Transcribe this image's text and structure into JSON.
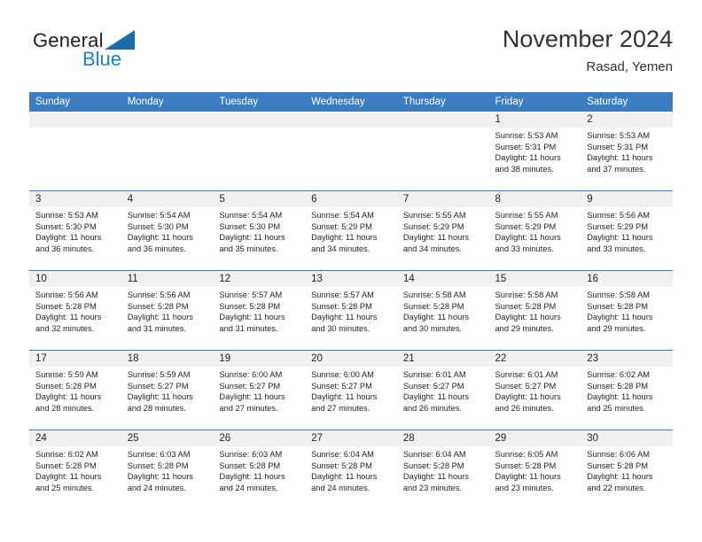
{
  "brand": {
    "name_dark": "General",
    "name_blue": "Blue",
    "triangle_color": "#1b6ca8",
    "blue_color": "#1b7fc4"
  },
  "header": {
    "title": "November 2024",
    "location": "Rasad, Yemen"
  },
  "theme": {
    "header_bg": "#3b7dc0",
    "header_text": "#ffffff",
    "daynum_band_bg": "#f0f0f0",
    "row_rule": "#3b7dc0",
    "body_text": "#231f20"
  },
  "weekdays": [
    "Sunday",
    "Monday",
    "Tuesday",
    "Wednesday",
    "Thursday",
    "Friday",
    "Saturday"
  ],
  "labels": {
    "sunrise": "Sunrise:",
    "sunset": "Sunset:",
    "daylight": "Daylight:"
  },
  "weeks": [
    [
      {
        "day": ""
      },
      {
        "day": ""
      },
      {
        "day": ""
      },
      {
        "day": ""
      },
      {
        "day": ""
      },
      {
        "day": "1",
        "sunrise": "Sunrise: 5:53 AM",
        "sunset": "Sunset: 5:31 PM",
        "daylight_1": "Daylight: 11 hours",
        "daylight_2": "and 38 minutes."
      },
      {
        "day": "2",
        "sunrise": "Sunrise: 5:53 AM",
        "sunset": "Sunset: 5:31 PM",
        "daylight_1": "Daylight: 11 hours",
        "daylight_2": "and 37 minutes."
      }
    ],
    [
      {
        "day": "3",
        "sunrise": "Sunrise: 5:53 AM",
        "sunset": "Sunset: 5:30 PM",
        "daylight_1": "Daylight: 11 hours",
        "daylight_2": "and 36 minutes."
      },
      {
        "day": "4",
        "sunrise": "Sunrise: 5:54 AM",
        "sunset": "Sunset: 5:30 PM",
        "daylight_1": "Daylight: 11 hours",
        "daylight_2": "and 36 minutes."
      },
      {
        "day": "5",
        "sunrise": "Sunrise: 5:54 AM",
        "sunset": "Sunset: 5:30 PM",
        "daylight_1": "Daylight: 11 hours",
        "daylight_2": "and 35 minutes."
      },
      {
        "day": "6",
        "sunrise": "Sunrise: 5:54 AM",
        "sunset": "Sunset: 5:29 PM",
        "daylight_1": "Daylight: 11 hours",
        "daylight_2": "and 34 minutes."
      },
      {
        "day": "7",
        "sunrise": "Sunrise: 5:55 AM",
        "sunset": "Sunset: 5:29 PM",
        "daylight_1": "Daylight: 11 hours",
        "daylight_2": "and 34 minutes."
      },
      {
        "day": "8",
        "sunrise": "Sunrise: 5:55 AM",
        "sunset": "Sunset: 5:29 PM",
        "daylight_1": "Daylight: 11 hours",
        "daylight_2": "and 33 minutes."
      },
      {
        "day": "9",
        "sunrise": "Sunrise: 5:56 AM",
        "sunset": "Sunset: 5:29 PM",
        "daylight_1": "Daylight: 11 hours",
        "daylight_2": "and 33 minutes."
      }
    ],
    [
      {
        "day": "10",
        "sunrise": "Sunrise: 5:56 AM",
        "sunset": "Sunset: 5:28 PM",
        "daylight_1": "Daylight: 11 hours",
        "daylight_2": "and 32 minutes."
      },
      {
        "day": "11",
        "sunrise": "Sunrise: 5:56 AM",
        "sunset": "Sunset: 5:28 PM",
        "daylight_1": "Daylight: 11 hours",
        "daylight_2": "and 31 minutes."
      },
      {
        "day": "12",
        "sunrise": "Sunrise: 5:57 AM",
        "sunset": "Sunset: 5:28 PM",
        "daylight_1": "Daylight: 11 hours",
        "daylight_2": "and 31 minutes."
      },
      {
        "day": "13",
        "sunrise": "Sunrise: 5:57 AM",
        "sunset": "Sunset: 5:28 PM",
        "daylight_1": "Daylight: 11 hours",
        "daylight_2": "and 30 minutes."
      },
      {
        "day": "14",
        "sunrise": "Sunrise: 5:58 AM",
        "sunset": "Sunset: 5:28 PM",
        "daylight_1": "Daylight: 11 hours",
        "daylight_2": "and 30 minutes."
      },
      {
        "day": "15",
        "sunrise": "Sunrise: 5:58 AM",
        "sunset": "Sunset: 5:28 PM",
        "daylight_1": "Daylight: 11 hours",
        "daylight_2": "and 29 minutes."
      },
      {
        "day": "16",
        "sunrise": "Sunrise: 5:58 AM",
        "sunset": "Sunset: 5:28 PM",
        "daylight_1": "Daylight: 11 hours",
        "daylight_2": "and 29 minutes."
      }
    ],
    [
      {
        "day": "17",
        "sunrise": "Sunrise: 5:59 AM",
        "sunset": "Sunset: 5:28 PM",
        "daylight_1": "Daylight: 11 hours",
        "daylight_2": "and 28 minutes."
      },
      {
        "day": "18",
        "sunrise": "Sunrise: 5:59 AM",
        "sunset": "Sunset: 5:27 PM",
        "daylight_1": "Daylight: 11 hours",
        "daylight_2": "and 28 minutes."
      },
      {
        "day": "19",
        "sunrise": "Sunrise: 6:00 AM",
        "sunset": "Sunset: 5:27 PM",
        "daylight_1": "Daylight: 11 hours",
        "daylight_2": "and 27 minutes."
      },
      {
        "day": "20",
        "sunrise": "Sunrise: 6:00 AM",
        "sunset": "Sunset: 5:27 PM",
        "daylight_1": "Daylight: 11 hours",
        "daylight_2": "and 27 minutes."
      },
      {
        "day": "21",
        "sunrise": "Sunrise: 6:01 AM",
        "sunset": "Sunset: 5:27 PM",
        "daylight_1": "Daylight: 11 hours",
        "daylight_2": "and 26 minutes."
      },
      {
        "day": "22",
        "sunrise": "Sunrise: 6:01 AM",
        "sunset": "Sunset: 5:27 PM",
        "daylight_1": "Daylight: 11 hours",
        "daylight_2": "and 26 minutes."
      },
      {
        "day": "23",
        "sunrise": "Sunrise: 6:02 AM",
        "sunset": "Sunset: 5:28 PM",
        "daylight_1": "Daylight: 11 hours",
        "daylight_2": "and 25 minutes."
      }
    ],
    [
      {
        "day": "24",
        "sunrise": "Sunrise: 6:02 AM",
        "sunset": "Sunset: 5:28 PM",
        "daylight_1": "Daylight: 11 hours",
        "daylight_2": "and 25 minutes."
      },
      {
        "day": "25",
        "sunrise": "Sunrise: 6:03 AM",
        "sunset": "Sunset: 5:28 PM",
        "daylight_1": "Daylight: 11 hours",
        "daylight_2": "and 24 minutes."
      },
      {
        "day": "26",
        "sunrise": "Sunrise: 6:03 AM",
        "sunset": "Sunset: 5:28 PM",
        "daylight_1": "Daylight: 11 hours",
        "daylight_2": "and 24 minutes."
      },
      {
        "day": "27",
        "sunrise": "Sunrise: 6:04 AM",
        "sunset": "Sunset: 5:28 PM",
        "daylight_1": "Daylight: 11 hours",
        "daylight_2": "and 24 minutes."
      },
      {
        "day": "28",
        "sunrise": "Sunrise: 6:04 AM",
        "sunset": "Sunset: 5:28 PM",
        "daylight_1": "Daylight: 11 hours",
        "daylight_2": "and 23 minutes."
      },
      {
        "day": "29",
        "sunrise": "Sunrise: 6:05 AM",
        "sunset": "Sunset: 5:28 PM",
        "daylight_1": "Daylight: 11 hours",
        "daylight_2": "and 23 minutes."
      },
      {
        "day": "30",
        "sunrise": "Sunrise: 6:06 AM",
        "sunset": "Sunset: 5:28 PM",
        "daylight_1": "Daylight: 11 hours",
        "daylight_2": "and 22 minutes."
      }
    ]
  ]
}
